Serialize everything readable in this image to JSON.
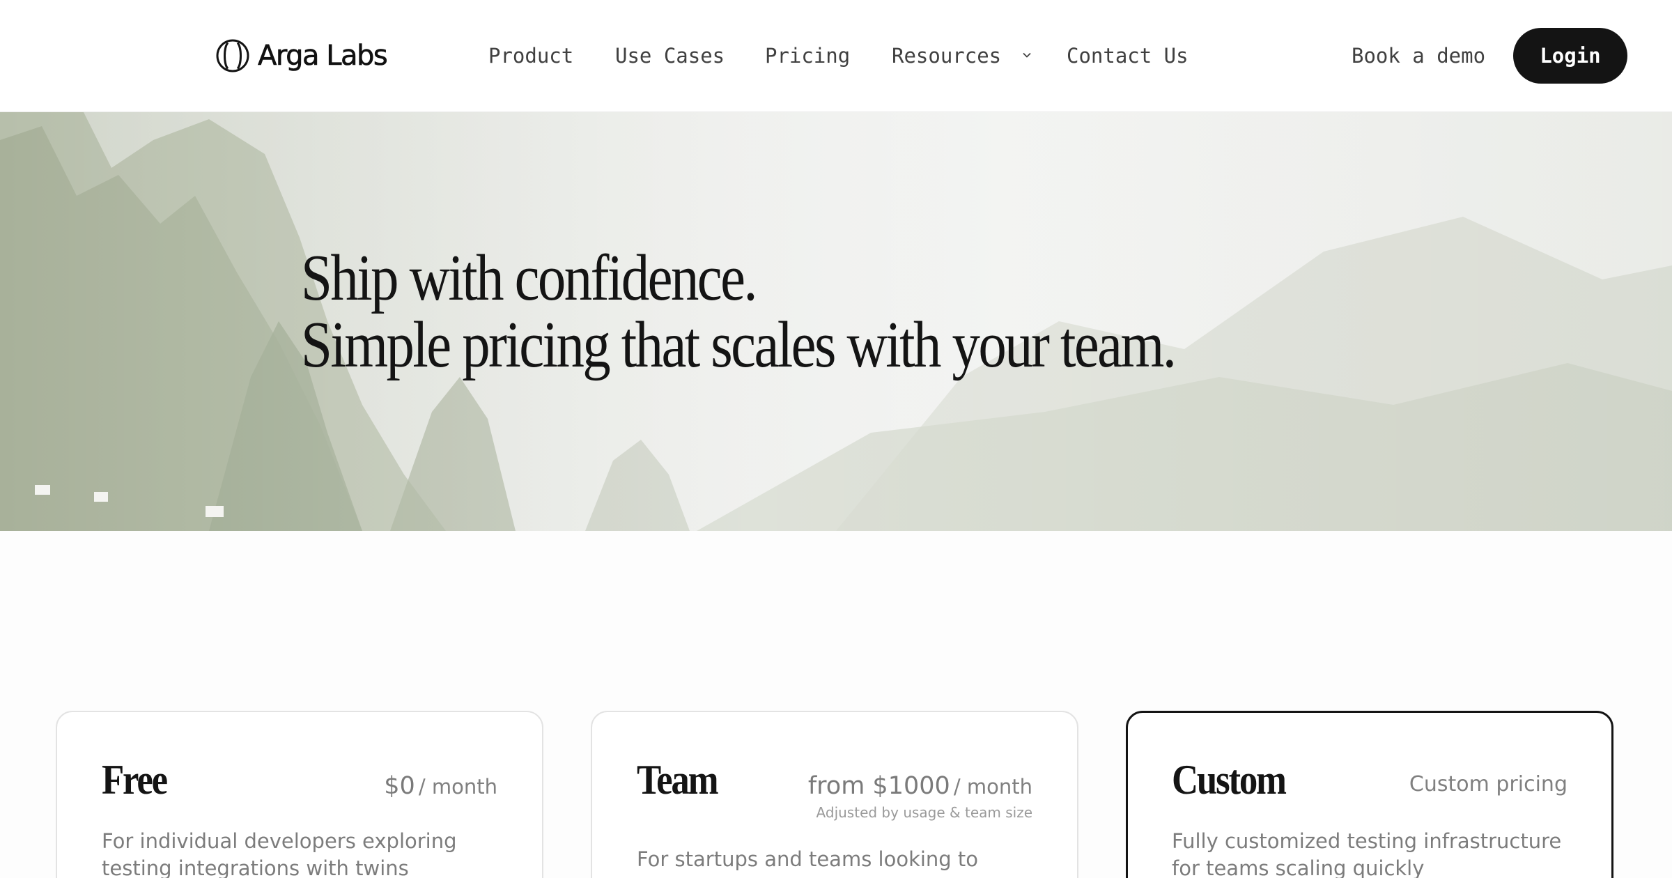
{
  "brand": {
    "name": "Arga Labs",
    "logo_icon": "circle-split-icon"
  },
  "nav": {
    "items": [
      {
        "label": "Product"
      },
      {
        "label": "Use Cases"
      },
      {
        "label": "Pricing"
      },
      {
        "label": "Resources",
        "icon": "chevron-down-icon"
      },
      {
        "label": "Contact Us"
      }
    ],
    "book_demo": "Book a demo",
    "login": "Login"
  },
  "hero": {
    "line1": "Ship with confidence.",
    "line2": "Simple pricing that scales with your team."
  },
  "plans": [
    {
      "name": "Free",
      "price": "$0",
      "unit": "/ month",
      "description": "For individual developers exploring testing integrations with twins"
    },
    {
      "name": "Team",
      "price": "from $1000",
      "unit": "/ month",
      "note": "Adjusted by usage & team size",
      "description": "For startups and teams looking to"
    },
    {
      "name": "Custom",
      "price_text": "Custom pricing",
      "description": "Fully customized testing infrastructure for teams scaling quickly",
      "selected": true
    }
  ],
  "colors": {
    "button_dark": "#141414",
    "nav_text": "#404040",
    "muted_text": "#7c7c7c",
    "card_border": "#e3e3e3",
    "selected_border": "#141414"
  }
}
